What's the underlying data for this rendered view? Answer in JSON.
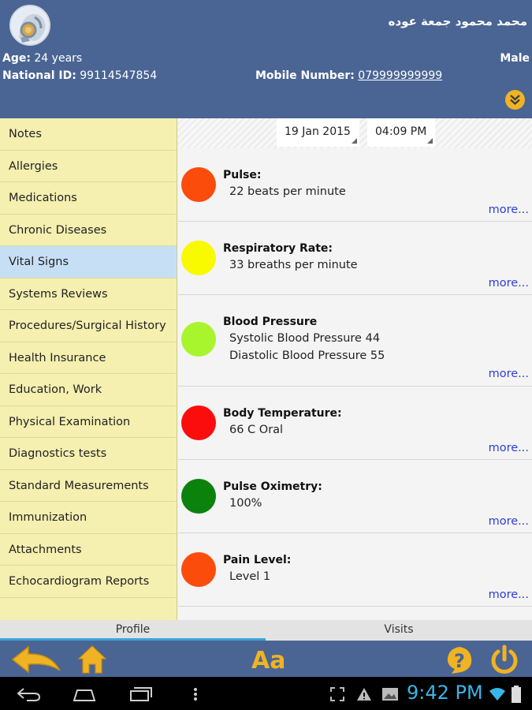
{
  "header": {
    "patient_name": "محمد محمود جمعة عوده",
    "age_label": "Age:",
    "age_value": " 24 years",
    "national_id_label": "National ID:",
    "national_id_value": " 99114547854",
    "gender": "Male",
    "mobile_label": "Mobile Number:",
    "mobile_value": "079999999999"
  },
  "sidebar": {
    "items": [
      {
        "label": "Notes"
      },
      {
        "label": "Allergies"
      },
      {
        "label": "Medications"
      },
      {
        "label": "Chronic Diseases"
      },
      {
        "label": "Vital Signs",
        "active": true
      },
      {
        "label": "Systems Reviews"
      },
      {
        "label": "Procedures/Surgical History"
      },
      {
        "label": "Health Insurance"
      },
      {
        "label": "Education, Work"
      },
      {
        "label": "Physical Examination"
      },
      {
        "label": "Diagnostics tests"
      },
      {
        "label": "Standard Measurements"
      },
      {
        "label": "Immunization"
      },
      {
        "label": "Attachments"
      },
      {
        "label": "Echocardiogram Reports"
      }
    ]
  },
  "main": {
    "date": "19 Jan 2015",
    "time": "04:09 PM",
    "more_label": "more...",
    "vitals": [
      {
        "title": "Pulse:",
        "lines": [
          "22 beats per minute"
        ],
        "color": "#fb4c0b"
      },
      {
        "title": "Respiratory Rate:",
        "lines": [
          "33 breaths per minute"
        ],
        "color": "#f9f900"
      },
      {
        "title": "Blood Pressure",
        "lines": [
          "Systolic Blood Pressure 44",
          "Diastolic Blood Pressure 55"
        ],
        "color": "#a8f52e"
      },
      {
        "title": "Body Temperature:",
        "lines": [
          "66 C Oral"
        ],
        "color": "#fb0d0d"
      },
      {
        "title": "Pulse Oximetry:",
        "lines": [
          "100%"
        ],
        "color": "#0b820b"
      },
      {
        "title": "Pain Level:",
        "lines": [
          "Level 1"
        ],
        "color": "#fb4c0b"
      }
    ]
  },
  "tabs": {
    "profile": "Profile",
    "visits": "Visits"
  },
  "toolbar": {
    "font_label": "Aa",
    "accent": "#f0b323",
    "icons": [
      "back-arrow-icon",
      "home-icon",
      "font-size-icon",
      "help-icon",
      "power-icon"
    ]
  },
  "statusbar": {
    "time": "9:42 PM",
    "clock_color": "#39b6e8"
  }
}
